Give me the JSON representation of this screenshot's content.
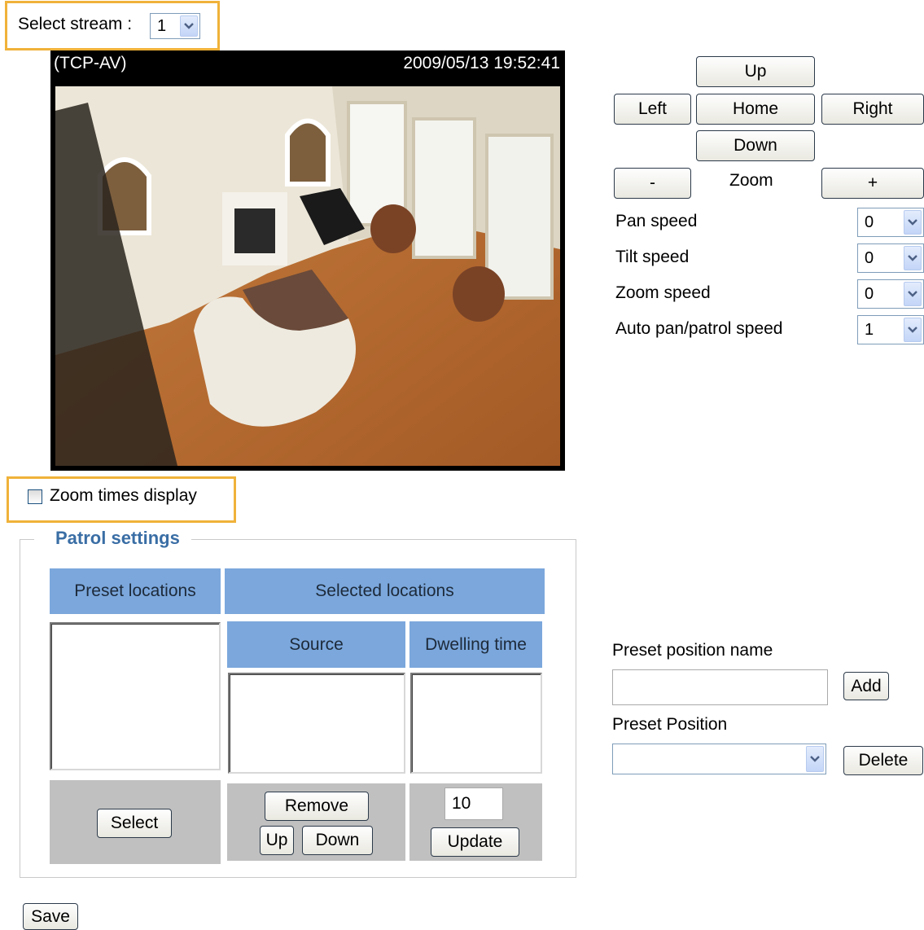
{
  "stream": {
    "label": "Select stream :",
    "value": "1"
  },
  "video": {
    "protocol": "(TCP-AV)",
    "timestamp": "2009/05/13 19:52:41"
  },
  "ptz": {
    "up": "Up",
    "left": "Left",
    "home": "Home",
    "right": "Right",
    "down": "Down",
    "zoom_out": "-",
    "zoom_label": "Zoom",
    "zoom_in": "+"
  },
  "speeds": [
    {
      "label": "Pan speed",
      "value": "0"
    },
    {
      "label": "Tilt speed",
      "value": "0"
    },
    {
      "label": "Zoom speed",
      "value": "0"
    },
    {
      "label": "Auto pan/patrol speed",
      "value": "1"
    }
  ],
  "zoom_times": {
    "label": "Zoom times display",
    "checked": false
  },
  "patrol": {
    "title": "Patrol settings",
    "preset_locations": "Preset locations",
    "selected_locations": "Selected locations",
    "source": "Source",
    "dwelling_time": "Dwelling time",
    "select_button": "Select",
    "remove_button": "Remove",
    "up_button": "Up",
    "down_button": "Down",
    "dwell_value": "10",
    "update_button": "Update"
  },
  "preset": {
    "name_label": "Preset position name",
    "name_value": "",
    "add_button": "Add",
    "position_label": "Preset Position",
    "position_value": "",
    "delete_button": "Delete"
  },
  "save_button": "Save",
  "icons": {
    "dropdown": "chevron-down-icon"
  },
  "colors": {
    "highlight": "#f0b23a",
    "header_blue": "#7ba7dc",
    "legend_blue": "#3a6ea5"
  }
}
